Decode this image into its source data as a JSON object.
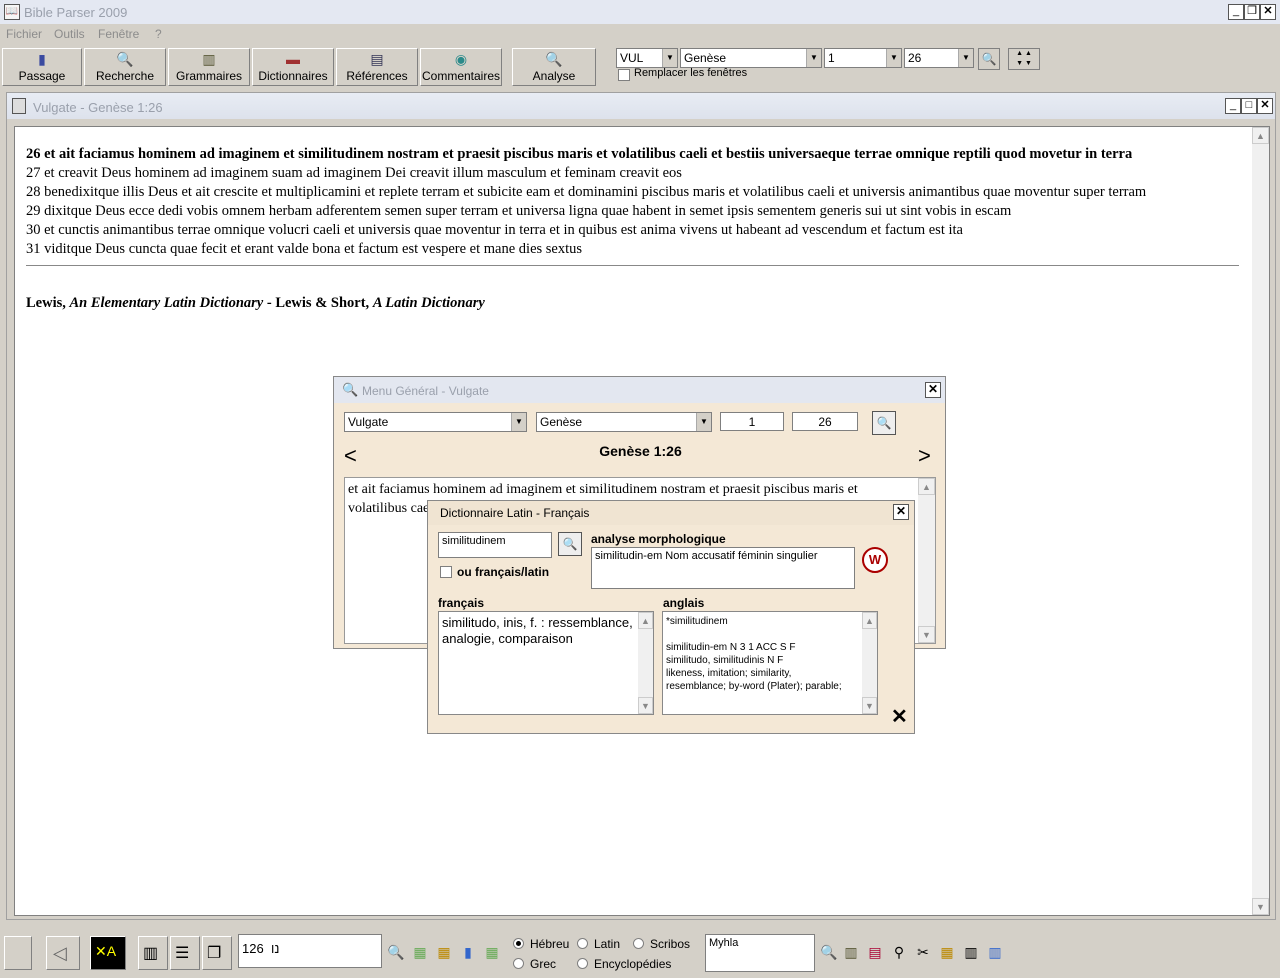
{
  "app": {
    "title": "Bible Parser 2009"
  },
  "menubar": [
    "Fichier",
    "Outils",
    "Fenêtre",
    "?"
  ],
  "toolbar": {
    "buttons": [
      "Passage",
      "Recherche",
      "Grammaires",
      "Dictionnaires",
      "Références",
      "Commentaires"
    ],
    "analyse": "Analyse",
    "version": "VUL",
    "book": "Genèse",
    "chapter": "1",
    "verse": "26",
    "replace_label": "Remplacer les fenêtres"
  },
  "doc": {
    "title": "Vulgate - Genèse 1:26",
    "verses": [
      "26 et ait faciamus hominem ad imaginem et similitudinem nostram et praesit piscibus maris et volatilibus caeli et bestiis universaeque terrae omnique reptili quod movetur in terra",
      "27 et creavit Deus hominem ad imaginem suam ad imaginem Dei creavit illum masculum et feminam creavit eos",
      "28 benedixitque illis Deus et ait crescite et multiplicamini et replete terram et subicite eam et dominamini piscibus maris et volatilibus caeli et universis animantibus quae moventur super terram",
      "29 dixitque Deus ecce dedi vobis omnem herbam adferentem semen super terram et universa ligna quae habent in semet ipsis sementem generis sui ut sint vobis in escam",
      "30 et cunctis animantibus terrae omnique volucri caeli et universis quae moventur in terra et in quibus est anima vivens ut habeant ad vescendum et factum est ita",
      "31 viditque Deus cuncta quae fecit et erant valde bona et factum est vespere et mane dies sextus"
    ],
    "dict_line": {
      "a1": "Lewis, ",
      "b1": "An Elementary Latin Dictionary",
      "a2": " - Lewis & Short, ",
      "b2": "A Latin Dictionary"
    }
  },
  "menu_general": {
    "title": "Menu Général - Vulgate",
    "version": "Vulgate",
    "book": "Genèse",
    "chapter": "1",
    "verse": "26",
    "reference": "Genèse 1:26",
    "prev": "<",
    "next": ">",
    "text": "et ait faciamus hominem ad imaginem et similitudinem nostram et praesit piscibus maris et",
    "text2": "volatilibus cae"
  },
  "dictionary": {
    "title": "Dictionnaire Latin - Français",
    "word": "similitudinem",
    "or_label": "ou français/latin",
    "morph_label": "analyse morphologique",
    "morph_text": "similitudin-em Nom accusatif féminin singulier",
    "fr_label": "français",
    "fr_text": "similitudo, inis, f. : ressemblance, analogie, comparaison",
    "en_label": "anglais",
    "en_lines": [
      "*similitudinem",
      "",
      "similitudin-em N 3 1 ACC S F",
      "similitudo, similitudinis N F",
      "likeness, imitation; similarity,",
      "resemblance; by-word (Plater); parable;"
    ]
  },
  "statusbar": {
    "ref_symbol": "נו",
    "ref_value": "126",
    "radios": [
      "Hébreu",
      "Latin",
      "Scribos",
      "Grec",
      "Encyclopédies"
    ],
    "selected": "Hébreu",
    "name_field": "Myhla"
  }
}
